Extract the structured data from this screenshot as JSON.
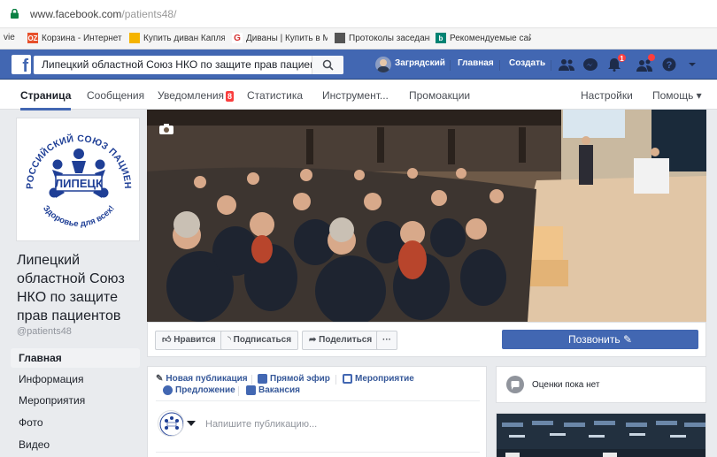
{
  "browser": {
    "url_prefix": "www.facebook.com",
    "url_path": "/patients48/",
    "bookmarks": [
      {
        "icon": "ebay-icon",
        "label": "vie"
      },
      {
        "icon": "ozon-icon",
        "label": "Корзина - Интернет"
      },
      {
        "icon": "folder-icon",
        "label": "Купить диван Капля"
      },
      {
        "icon": "google-icon",
        "label": "Диваны | Купить в М"
      },
      {
        "icon": "document-icon",
        "label": "Протоколы заседани"
      },
      {
        "icon": "bing-icon",
        "label": "Рекомендуемые сай"
      }
    ]
  },
  "topbar": {
    "logo": "f",
    "search_value": "Липецкий областной Союз НКО по защите прав пациентов",
    "user_name": "Загрядский",
    "home_label": "Главная",
    "create_label": "Создать",
    "notifications_count": "1"
  },
  "tabs": {
    "page": "Страница",
    "messages": "Сообщения",
    "notifications": "Уведомления",
    "notifications_badge": "8",
    "stats": "Статистика",
    "tools": "Инструмент...",
    "promotions": "Промоакции",
    "settings": "Настройки",
    "help": "Помощь ▾"
  },
  "page": {
    "name": "Липецкий областной Союз НКО по защите прав пациентов",
    "handle": "@patients48",
    "logo_text": {
      "top": "ВСЕРОССИЙСКИЙ СОЮЗ ПАЦИЕНТОВ",
      "center": "ЛИПЕЦК",
      "bottom": "Здоровье для всех!"
    }
  },
  "left_nav": [
    "Главная",
    "Информация",
    "Мероприятия",
    "Фото",
    "Видео"
  ],
  "actions": {
    "like": "Нравится",
    "follow": "Подписаться",
    "share": "Поделиться",
    "more": "···",
    "call": "Позвонить"
  },
  "composer": {
    "new_post": "Новая публикация",
    "live": "Прямой эфир",
    "event": "Мероприятие",
    "offer": "Предложение",
    "job": "Вакансия",
    "placeholder": "Напишите публикацию..."
  },
  "ratings": {
    "text": "Оценки пока нет"
  },
  "colors": {
    "brand": "#4267b2",
    "link": "#365899",
    "badge": "#fa3e3e"
  }
}
